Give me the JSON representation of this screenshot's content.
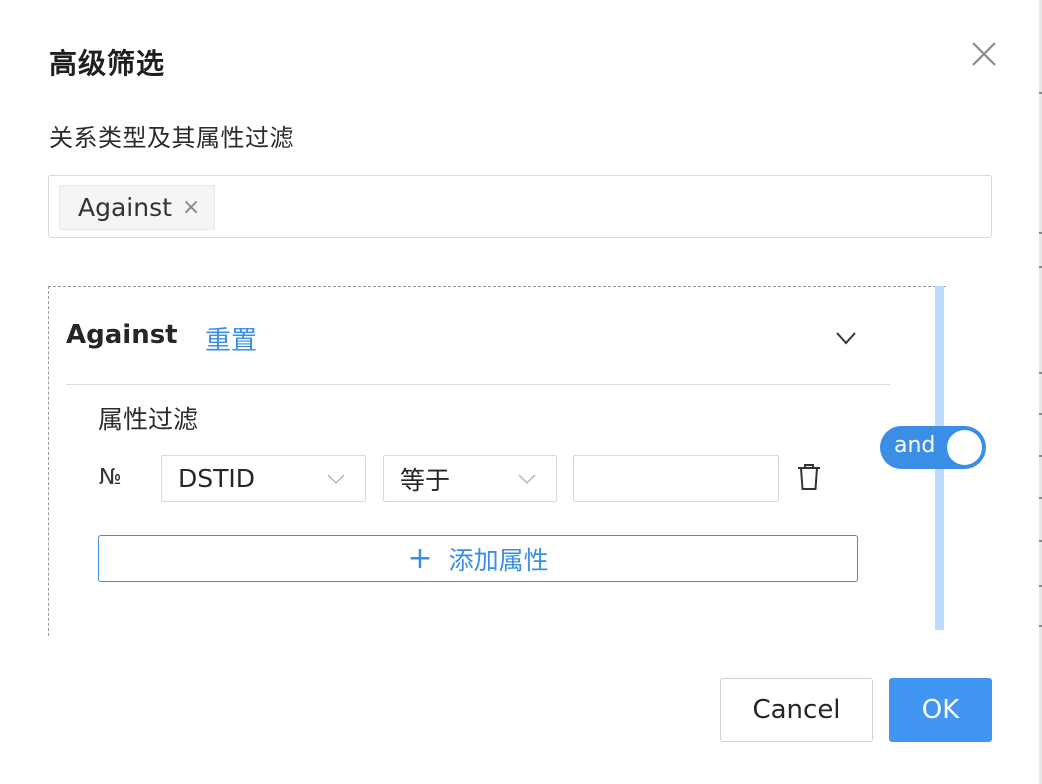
{
  "dialog": {
    "title": "高级筛选"
  },
  "relation_filter": {
    "label": "关系类型及其属性过滤",
    "selected_tags": [
      "Against"
    ]
  },
  "panel": {
    "title": "Against",
    "reset_label": "重置",
    "property_filter_label": "属性过滤",
    "rows": [
      {
        "index_symbol": "№",
        "field": "DSTID",
        "operator": "等于",
        "value": ""
      }
    ],
    "add_property_label": "添加属性",
    "logic_toggle": {
      "label": "and",
      "on": true
    }
  },
  "footer": {
    "cancel_label": "Cancel",
    "ok_label": "OK"
  },
  "colors": {
    "accent": "#3a8ee6",
    "primary_button": "#4096f0",
    "rail": "#bcdcfc"
  },
  "icons": [
    "close-icon",
    "tag-close-icon",
    "chevron-down-icon",
    "trash-icon",
    "plus-icon"
  ]
}
